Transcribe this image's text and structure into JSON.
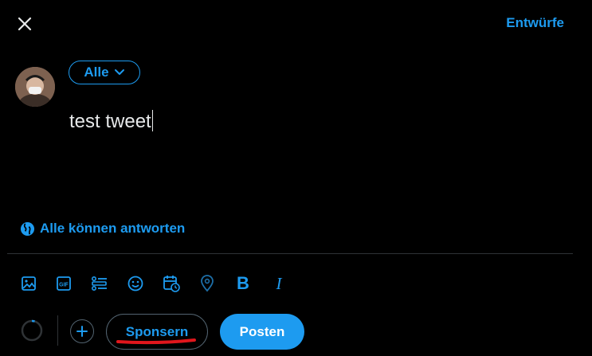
{
  "header": {
    "close_icon": "close-icon",
    "drafts_label": "Entwürfe"
  },
  "composer": {
    "audience_label": "Alle",
    "text": "test tweet",
    "reply_setting_label": "Alle können antworten",
    "reply_setting_icon": "globe-person-icon"
  },
  "toolbar": {
    "icons": [
      "image-icon",
      "gif-icon",
      "poll-icon",
      "emoji-icon",
      "schedule-icon",
      "location-icon",
      "bold-icon",
      "italic-icon"
    ],
    "gif_text": "GIF",
    "bold_glyph": "B",
    "italic_glyph": "I"
  },
  "footer": {
    "sponsor_label": "Sponsern",
    "post_label": "Posten"
  },
  "colors": {
    "accent": "#1d9bf0",
    "background": "#000000",
    "text": "#e7e9ea",
    "border": "#2f3336",
    "annotation": "#e0161c"
  }
}
